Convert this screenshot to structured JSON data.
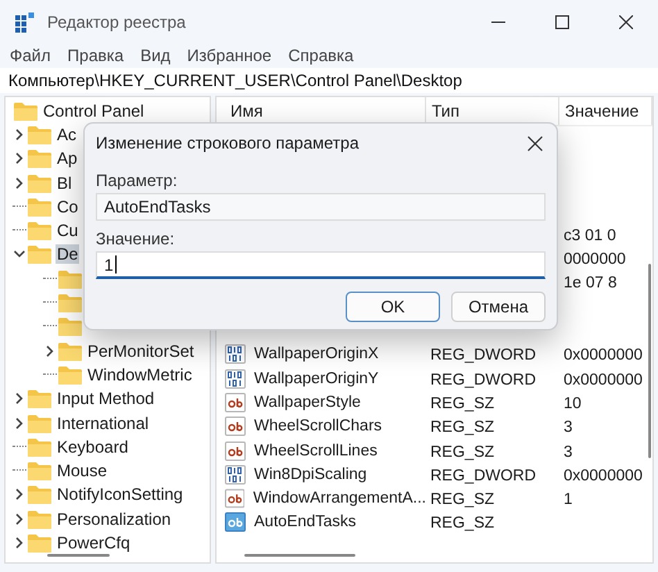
{
  "window": {
    "title": "Редактор реестра"
  },
  "menu": [
    "Файл",
    "Правка",
    "Вид",
    "Избранное",
    "Справка"
  ],
  "address": "Компьютер\\HKEY_CURRENT_USER\\Control Panel\\Desktop",
  "tree": [
    {
      "label": "Control Panel",
      "selected": false,
      "children": [
        {
          "label": "Ac",
          "expandable": true,
          "expanded": false,
          "selected": false
        },
        {
          "label": "Ap",
          "expandable": true,
          "expanded": false,
          "selected": false
        },
        {
          "label": "Bl",
          "expandable": true,
          "expanded": false,
          "selected": false
        },
        {
          "label": "Co",
          "expandable": false,
          "selected": false
        },
        {
          "label": "Cu",
          "expandable": false,
          "selected": false
        },
        {
          "label": "De",
          "expandable": true,
          "expanded": true,
          "selected": true,
          "children": [
            {
              "expandable": false
            },
            {
              "expandable": false
            },
            {
              "expandable": false
            },
            {
              "label": "PerMonitorSet",
              "expandable": true,
              "expanded": false,
              "selected": false
            },
            {
              "label": "WindowMetric",
              "expandable": false,
              "selected": false
            }
          ]
        },
        {
          "label": "Input Method",
          "expandable": true,
          "expanded": false,
          "selected": false
        },
        {
          "label": "International",
          "expandable": true,
          "expanded": false,
          "selected": false
        },
        {
          "label": "Keyboard",
          "expandable": false,
          "selected": false
        },
        {
          "label": "Mouse",
          "expandable": false,
          "selected": false
        },
        {
          "label": "NotifyIconSetting",
          "expandable": true,
          "expanded": false,
          "selected": false
        },
        {
          "label": "Personalization",
          "expandable": true,
          "expanded": false,
          "selected": false
        },
        {
          "label": "PowerCfq",
          "expandable": true,
          "expanded": false,
          "selected": false
        }
      ]
    }
  ],
  "table": {
    "columns": [
      "Имя",
      "Тип",
      "Значение"
    ],
    "rows": [
      {},
      {},
      {},
      {},
      {
        "value": "c3 01 0"
      },
      {
        "value": "0000000"
      },
      {
        "value": "1e 07 8"
      },
      {},
      {},
      {
        "kind": "dword",
        "name": "WallpaperOriginX",
        "type": "REG_DWORD",
        "value": "0x0000000"
      },
      {
        "kind": "dword",
        "name": "WallpaperOriginY",
        "type": "REG_DWORD",
        "value": "0x0000000"
      },
      {
        "kind": "string",
        "name": "WallpaperStyle",
        "type": "REG_SZ",
        "value": "10"
      },
      {
        "kind": "string",
        "name": "WheelScrollChars",
        "type": "REG_SZ",
        "value": "3"
      },
      {
        "kind": "string",
        "name": "WheelScrollLines",
        "type": "REG_SZ",
        "value": "3"
      },
      {
        "kind": "dword",
        "name": "Win8DpiScaling",
        "type": "REG_DWORD",
        "value": "0x0000000"
      },
      {
        "kind": "string",
        "name": "WindowArrangementA...",
        "type": "REG_SZ",
        "value": "1"
      },
      {
        "kind": "string",
        "name": "AutoEndTasks",
        "type": "REG_SZ",
        "selected": true
      }
    ]
  },
  "dialog": {
    "title": "Изменение строкового параметра",
    "name_label": "Параметр:",
    "name_value": "AutoEndTasks",
    "value_label": "Значение:",
    "value": "1",
    "buttons": [
      "OK",
      "Отмена"
    ]
  }
}
